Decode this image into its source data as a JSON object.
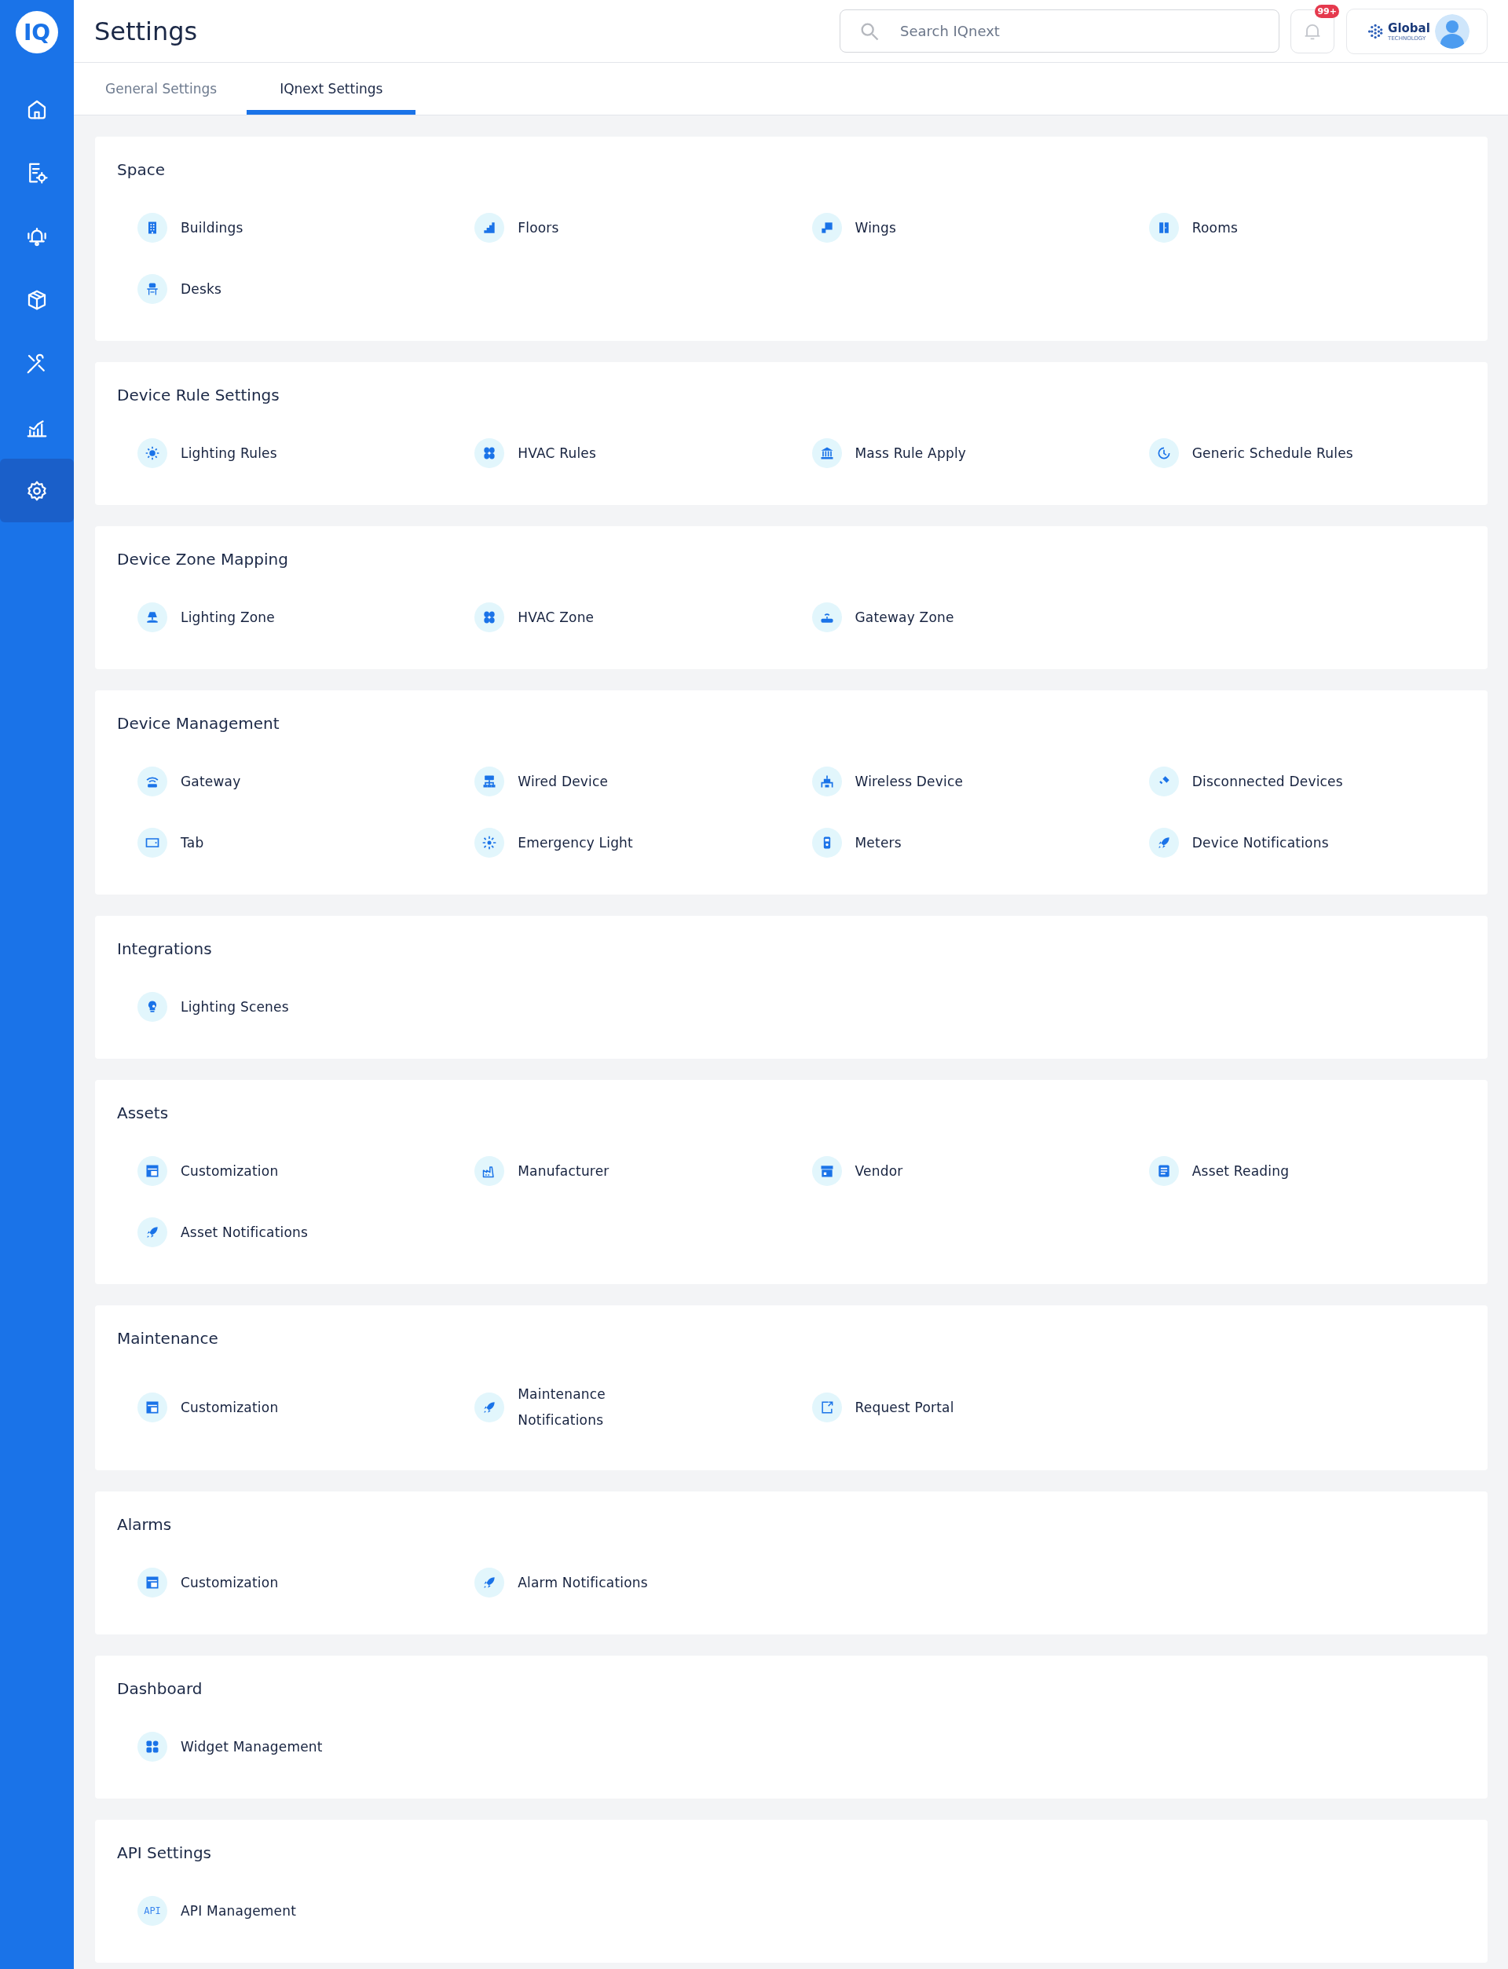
{
  "logo": {
    "text": "IQ"
  },
  "sidebar": {
    "items": [
      {
        "selected": false
      },
      {
        "selected": false
      },
      {
        "selected": false
      },
      {
        "selected": false
      },
      {
        "selected": false
      },
      {
        "selected": false
      },
      {
        "selected": true
      }
    ]
  },
  "header": {
    "title": "Settings",
    "search": {
      "placeholder": "Search IQnext"
    },
    "notifications": {
      "badge": "99+"
    },
    "brand": {
      "name": "Global",
      "tagline": "TECHNOLOGY"
    }
  },
  "tabs": [
    {
      "label": "General Settings",
      "selected": false
    },
    {
      "label": "IQnext Settings",
      "selected": true
    }
  ],
  "sections": [
    {
      "title": "Space",
      "items": [
        {
          "label": "Buildings"
        },
        {
          "label": "Floors"
        },
        {
          "label": "Wings"
        },
        {
          "label": "Rooms"
        },
        {
          "label": "Desks"
        }
      ]
    },
    {
      "title": "Device Rule Settings",
      "items": [
        {
          "label": "Lighting Rules"
        },
        {
          "label": "HVAC Rules"
        },
        {
          "label": "Mass Rule Apply"
        },
        {
          "label": "Generic Schedule Rules"
        }
      ]
    },
    {
      "title": "Device Zone Mapping",
      "items": [
        {
          "label": "Lighting Zone"
        },
        {
          "label": "HVAC Zone"
        },
        {
          "label": "Gateway Zone"
        }
      ]
    },
    {
      "title": "Device Management",
      "items": [
        {
          "label": "Gateway"
        },
        {
          "label": "Wired Device"
        },
        {
          "label": "Wireless Device"
        },
        {
          "label": "Disconnected Devices"
        },
        {
          "label": "Tab"
        },
        {
          "label": "Emergency Light"
        },
        {
          "label": "Meters"
        },
        {
          "label": "Device Notifications"
        }
      ]
    },
    {
      "title": "Integrations",
      "items": [
        {
          "label": "Lighting Scenes"
        }
      ]
    },
    {
      "title": "Assets",
      "items": [
        {
          "label": "Customization"
        },
        {
          "label": "Manufacturer"
        },
        {
          "label": "Vendor"
        },
        {
          "label": "Asset Reading"
        },
        {
          "label": "Asset Notifications"
        }
      ]
    },
    {
      "title": "Maintenance",
      "items": [
        {
          "label": "Customization"
        },
        {
          "label": "Maintenance\nNotifications"
        },
        {
          "label": "Request Portal"
        }
      ]
    },
    {
      "title": "Alarms",
      "items": [
        {
          "label": "Customization"
        },
        {
          "label": "Alarm Notifications"
        }
      ]
    },
    {
      "title": "Dashboard",
      "items": [
        {
          "label": "Widget Management"
        }
      ]
    },
    {
      "title": "API Settings",
      "items": [
        {
          "label": "API Management",
          "icon_text": "API"
        }
      ]
    }
  ]
}
